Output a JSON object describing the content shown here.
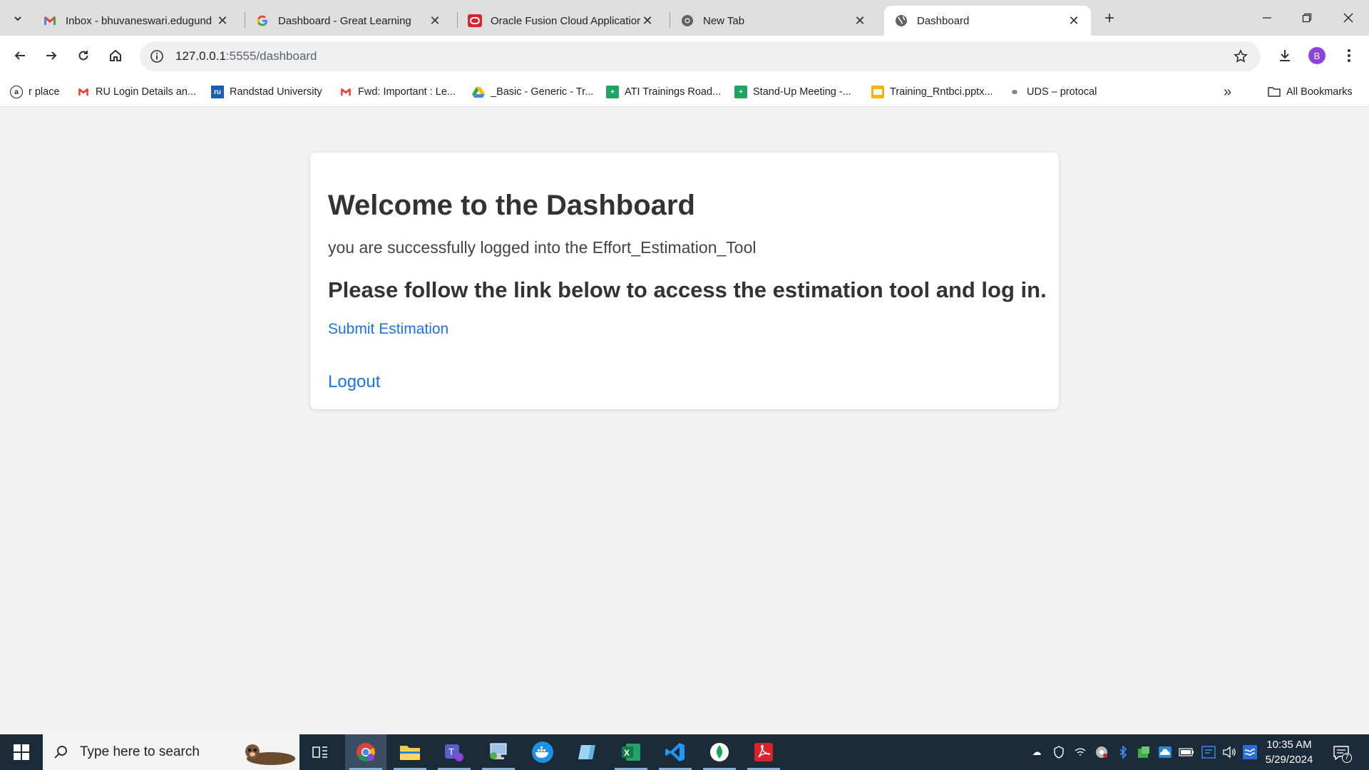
{
  "tabs": [
    {
      "title": "Inbox - bhuvaneswari.edugund",
      "icon": "gmail-icon"
    },
    {
      "title": "Dashboard - Great Learning",
      "icon": "google-icon"
    },
    {
      "title": "Oracle Fusion Cloud Applicatior",
      "icon": "oracle-icon"
    },
    {
      "title": "New Tab",
      "icon": "chrome-icon"
    },
    {
      "title": "Dashboard",
      "icon": "globe-icon"
    }
  ],
  "address_bar": {
    "host": "127.0.0.1",
    "path": ":5555/dashboard"
  },
  "profile_initial": "B",
  "bookmarks": [
    {
      "label": "r place",
      "icon": "amazon-icon"
    },
    {
      "label": "RU Login Details an...",
      "icon": "gmail-icon"
    },
    {
      "label": "Randstad University",
      "icon": "randstad-icon"
    },
    {
      "label": "Fwd: Important : Le...",
      "icon": "gmail-icon"
    },
    {
      "label": "_Basic - Generic - Tr...",
      "icon": "google-drive-icon"
    },
    {
      "label": "ATI Trainings Road...",
      "icon": "google-sheets-icon"
    },
    {
      "label": "Stand-Up Meeting -...",
      "icon": "google-sheets-icon"
    },
    {
      "label": "Training_Rntbci.pptx...",
      "icon": "google-slides-icon"
    },
    {
      "label": "UDS – protocal",
      "icon": "link-icon"
    }
  ],
  "all_bookmarks_label": "All Bookmarks",
  "page": {
    "heading": "Welcome to the Dashboard",
    "message": "you are successfully logged into the Effort_Estimation_Tool",
    "subheading": "Please follow the link below to access the estimation tool and log in.",
    "submit_link": "Submit Estimation",
    "logout_link": "Logout"
  },
  "taskbar": {
    "search_placeholder": "Type here to search",
    "time": "10:35 AM",
    "date": "5/29/2024",
    "notification_count": "7",
    "apps": [
      "chrome",
      "file-explorer",
      "teams",
      "remote-desktop",
      "docker",
      "notepad",
      "excel",
      "vscode",
      "mongodb-compass",
      "acrobat"
    ]
  },
  "colors": {
    "link": "#1a73e8",
    "heading": "#333333",
    "taskbar": "#1c2b3a",
    "page_bg": "#f2f2f2"
  }
}
